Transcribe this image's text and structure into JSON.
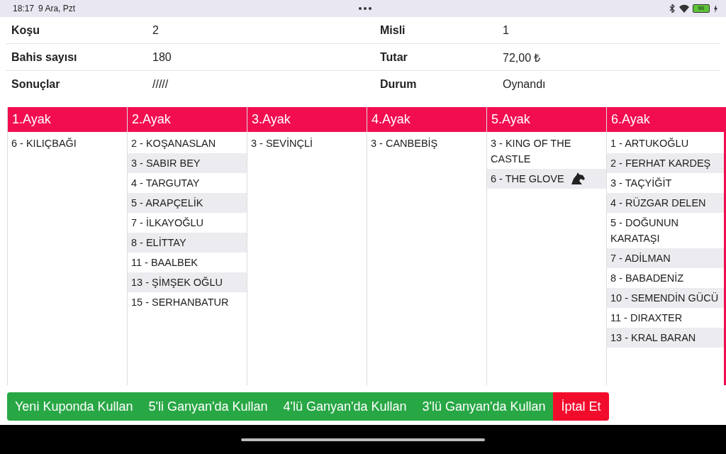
{
  "status_bar": {
    "time": "18:17",
    "date": "9 Ara, Pzt",
    "battery": "90"
  },
  "info": [
    {
      "label": "Koşu",
      "value": "2",
      "label2": "Misli",
      "value2": "1"
    },
    {
      "label": "Bahis sayısı",
      "value": "180",
      "label2": "Tutar",
      "value2": "72,00 ₺"
    },
    {
      "label": "Sonuçlar",
      "value": "/////",
      "label2": "Durum",
      "value2": "Oynandı"
    }
  ],
  "legs": [
    {
      "title": "1.Ayak",
      "runners": [
        {
          "name": "6 - KILIÇBAĞI",
          "horse_icon": false
        }
      ]
    },
    {
      "title": "2.Ayak",
      "runners": [
        {
          "name": "2 - KOŞANASLAN",
          "horse_icon": false
        },
        {
          "name": "3 - SABIR BEY",
          "horse_icon": false
        },
        {
          "name": "4 - TARGUTAY",
          "horse_icon": false
        },
        {
          "name": "5 - ARAPÇELİK",
          "horse_icon": false
        },
        {
          "name": "7 - İLKAYOĞLU",
          "horse_icon": false
        },
        {
          "name": "8 - ELİTTAY",
          "horse_icon": false
        },
        {
          "name": "11 - BAALBEK",
          "horse_icon": false
        },
        {
          "name": "13 - ŞİMŞEK OĞLU",
          "horse_icon": false
        },
        {
          "name": "15 - SERHANBATUR",
          "horse_icon": false
        }
      ]
    },
    {
      "title": "3.Ayak",
      "runners": [
        {
          "name": "3 - SEVİNÇLİ",
          "horse_icon": false
        }
      ]
    },
    {
      "title": "4.Ayak",
      "runners": [
        {
          "name": "3 - CANBEBİŞ",
          "horse_icon": false
        }
      ]
    },
    {
      "title": "5.Ayak",
      "runners": [
        {
          "name": "3 - KING OF THE CASTLE",
          "horse_icon": false
        },
        {
          "name": "6 - THE GLOVE",
          "horse_icon": true
        }
      ]
    },
    {
      "title": "6.Ayak",
      "runners": [
        {
          "name": "1 - ARTUKOĞLU",
          "horse_icon": false
        },
        {
          "name": "2 - FERHAT KARDEŞ",
          "horse_icon": false
        },
        {
          "name": "3 - TAÇYİĞİT",
          "horse_icon": false
        },
        {
          "name": "4 - RÜZGAR DELEN",
          "horse_icon": false
        },
        {
          "name": "5 - DOĞUNUN KARATAŞI",
          "horse_icon": false
        },
        {
          "name": "7 - ADİLMAN",
          "horse_icon": false
        },
        {
          "name": "8 - BABADENİZ",
          "horse_icon": false
        },
        {
          "name": "10 - SEMENDİN GÜCÜ",
          "horse_icon": false
        },
        {
          "name": "11 - DIRAXTER",
          "horse_icon": false
        },
        {
          "name": "13 - KRAL BARAN",
          "horse_icon": false
        }
      ]
    }
  ],
  "actions": [
    {
      "label": "Yeni Kuponda Kullan",
      "kind": "use"
    },
    {
      "label": "5'li Ganyan'da Kullan",
      "kind": "use"
    },
    {
      "label": "4'lü Ganyan'da Kullan",
      "kind": "use"
    },
    {
      "label": "3'lü Ganyan'da Kullan",
      "kind": "use"
    },
    {
      "label": "İptal Et",
      "kind": "cancel"
    }
  ]
}
